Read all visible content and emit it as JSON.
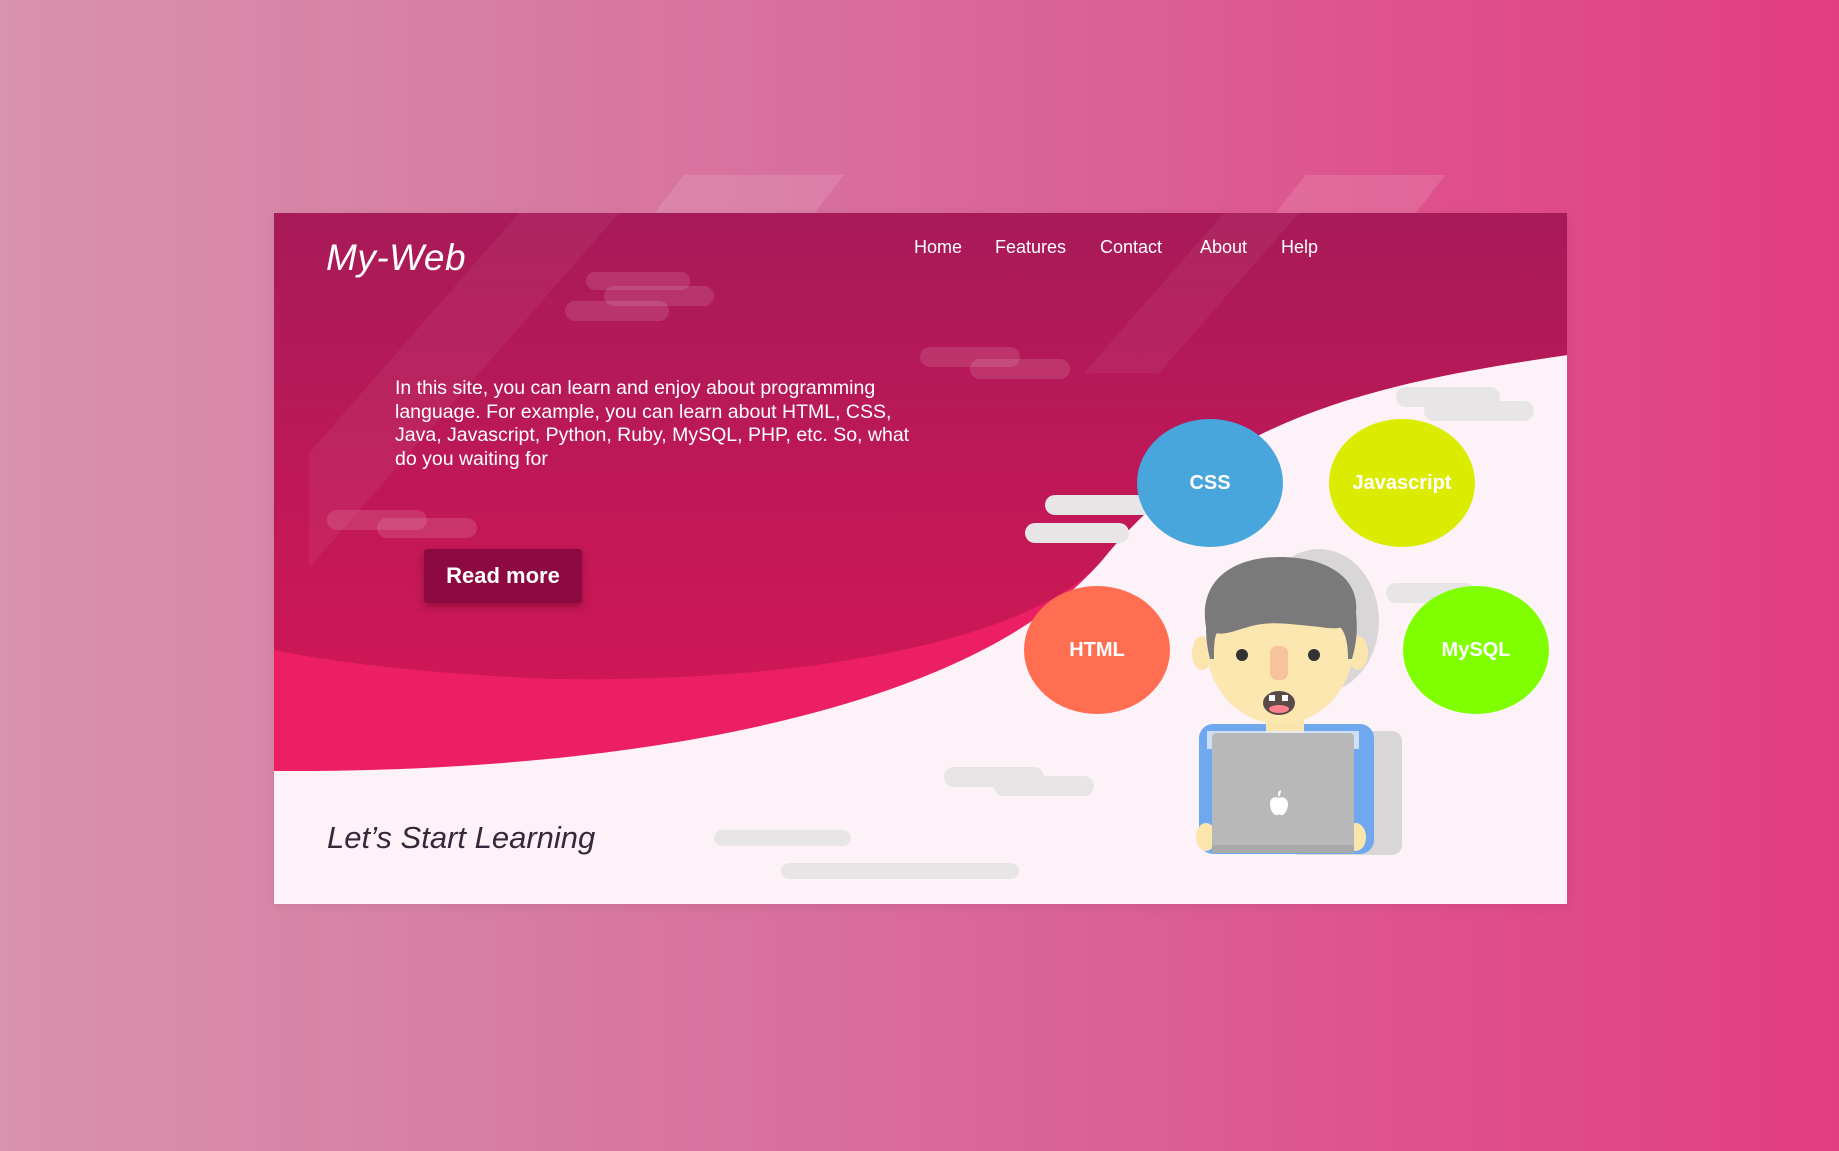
{
  "site": {
    "logo": "My-Web"
  },
  "nav": {
    "items": [
      "Home",
      "Features",
      "Contact",
      "About",
      "Help"
    ]
  },
  "hero": {
    "intro": "In this site, you can learn and enjoy about programming language. For example, you can learn about HTML, CSS, Java, Javascript, Python, Ruby, MySQL, PHP, etc. So, what do you waiting for",
    "cta_label": "Read more",
    "tagline": "Let’s Start Learning"
  },
  "bubbles": [
    {
      "label": "CSS",
      "color": "#48a6dc"
    },
    {
      "label": "Javascript",
      "color": "#dcec00"
    },
    {
      "label": "HTML",
      "color": "#ff6e50"
    },
    {
      "label": "MySQL",
      "color": "#80ff00"
    }
  ],
  "icons": {
    "laptop_logo": "apple-logo-icon"
  },
  "colors": {
    "hero_dark": "#a8185a",
    "hero_mid": "#c81755",
    "hero_bright": "#ec1f64",
    "button": "#8c0a3f",
    "page_bg": "#fdf2f7",
    "tagline": "#34283a"
  }
}
